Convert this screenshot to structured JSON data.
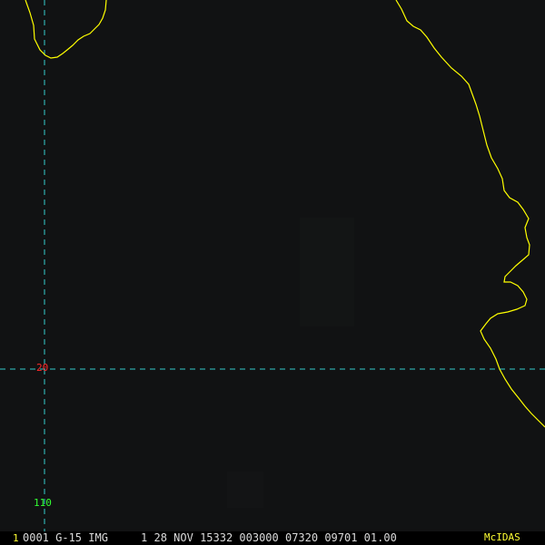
{
  "map": {
    "background": "#111213",
    "coastline_color": "#ffff00",
    "graticule_color": "#33cccc",
    "lat_label": "20",
    "lat_label_color": "#ff2a2a",
    "lon_label": "110",
    "lon_label_color": "#33ff33"
  },
  "statusbar": {
    "frame_number": "1",
    "header": "0001 G-15 IMG     1 28 NOV 15332 003000 07320 09701 01.00",
    "logo": "McIDAS"
  }
}
